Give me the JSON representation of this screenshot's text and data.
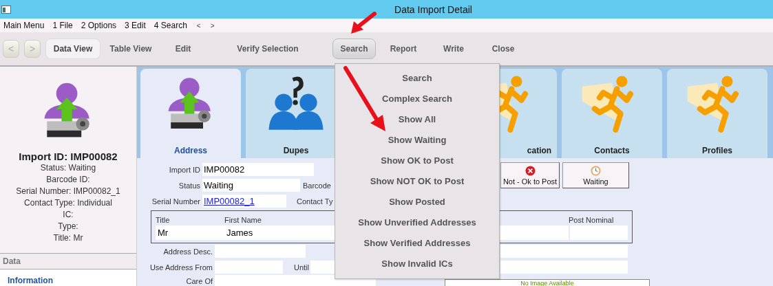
{
  "window": {
    "title": "Data Import Detail"
  },
  "menu_bar": [
    "Main Menu",
    "1 File",
    "2 Options",
    "3 Edit",
    "4 Search",
    "<",
    ">"
  ],
  "toolbar": {
    "nav": [
      "<",
      ">"
    ],
    "items": [
      {
        "label": "Data View",
        "selected": true,
        "open": false
      },
      {
        "label": "Table View",
        "selected": false,
        "open": false
      },
      {
        "label": "Edit",
        "selected": false,
        "open": false
      },
      {
        "label": "Verify Selection",
        "selected": false,
        "open": false
      },
      {
        "label": "Search",
        "selected": false,
        "open": true
      },
      {
        "label": "Report",
        "selected": false,
        "open": false
      },
      {
        "label": "Write",
        "selected": false,
        "open": false
      },
      {
        "label": "Close",
        "selected": false,
        "open": false
      }
    ]
  },
  "summary": {
    "heading": "Import ID: IMP00082",
    "lines": [
      "Status: Waiting",
      "Barcode ID:",
      "Serial Number: IMP00082_1",
      "Contact Type: Individual",
      "IC:",
      "Type:",
      "Title: Mr"
    ],
    "section": "Data",
    "link": "Information"
  },
  "tabs": [
    {
      "label": "Address",
      "kind": "upload",
      "selected": true,
      "partly_covered": false
    },
    {
      "label": "Dupes",
      "kind": "dupes",
      "selected": false,
      "partly_covered": false
    },
    {
      "label": "cation",
      "kind": "runner",
      "selected": false,
      "partly_covered": true
    },
    {
      "label": "Contacts",
      "kind": "runner",
      "selected": false,
      "partly_covered": false
    },
    {
      "label": "Profiles",
      "kind": "runner",
      "selected": false,
      "partly_covered": false
    }
  ],
  "form": {
    "import_id": {
      "label": "Import ID",
      "value": "IMP00082"
    },
    "status": {
      "label": "Status",
      "value": "Waiting"
    },
    "barcode_label": "Barcode",
    "serial_number": {
      "label": "Serial Number",
      "value": "IMP00082_1"
    },
    "contact_type_label": "Contact Ty",
    "name": {
      "title_label": "Title",
      "title": "Mr",
      "first_name_label": "First Name",
      "first_name": "James",
      "post_nominal_label": "Post Nominal"
    },
    "address_desc_label": "Address Desc.",
    "use_address_from_label": "Use Address From",
    "until_label": "Until",
    "care_of_label": "Care Of",
    "image_placeholder": "No Image Available"
  },
  "status_buttons": [
    {
      "label": "Not - Ok to Post",
      "kind": "not-ok"
    },
    {
      "label": "Waiting",
      "kind": "waiting"
    }
  ],
  "search_menu": [
    "Search",
    "Complex Search",
    "Show All",
    "Show Waiting",
    "Show OK to Post",
    "Show NOT OK to Post",
    "Show Posted",
    "Show Unverified Addresses",
    "Show Verified Addresses",
    "Show Invalid ICs"
  ]
}
